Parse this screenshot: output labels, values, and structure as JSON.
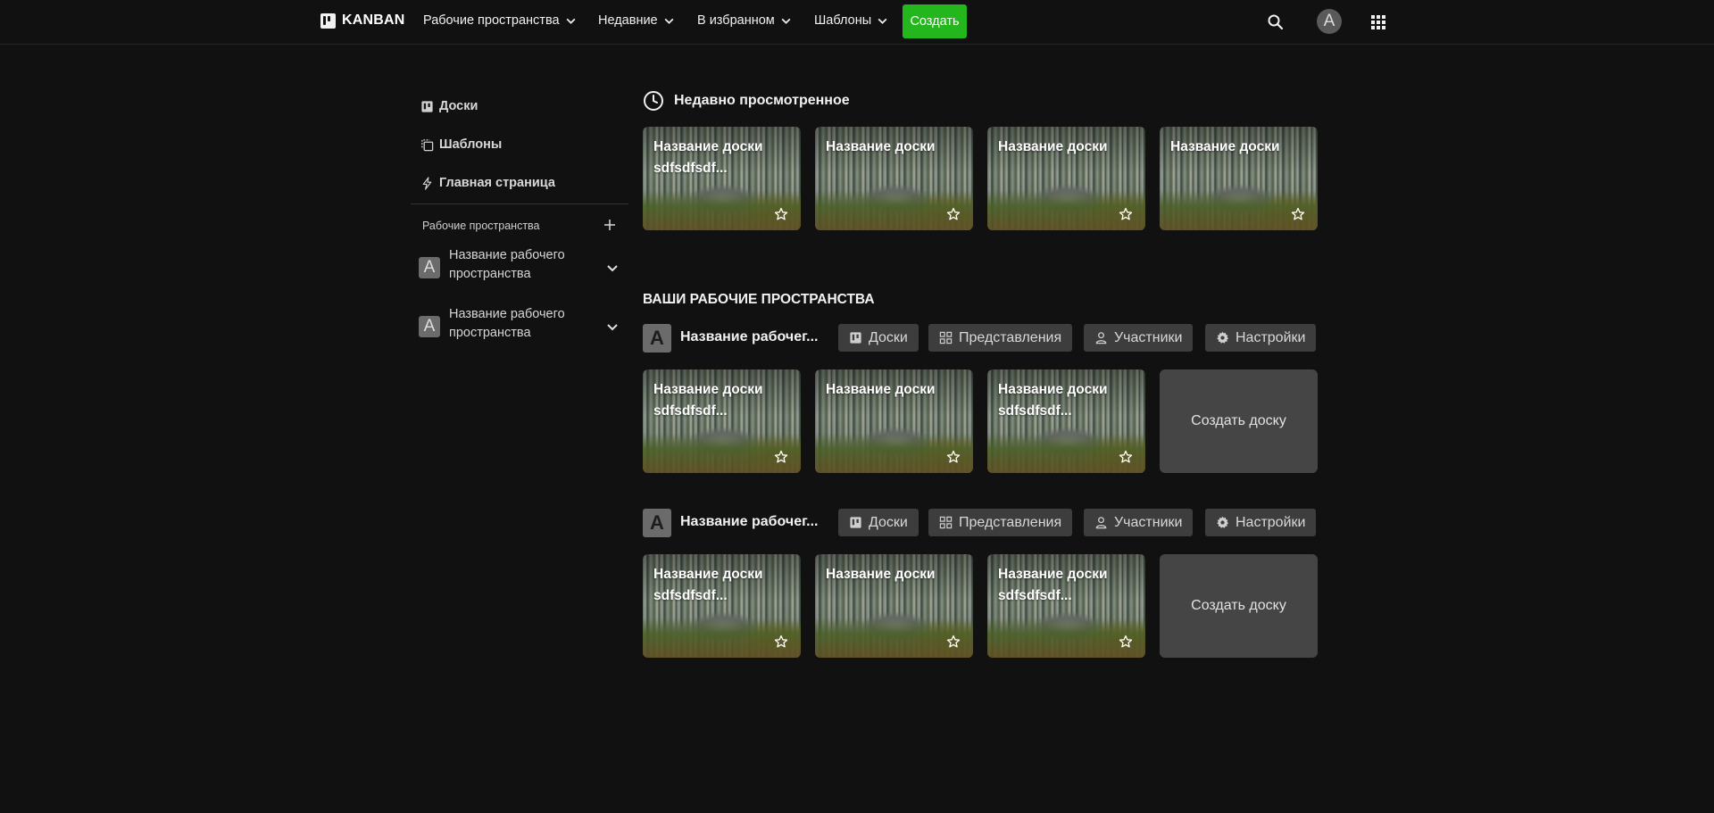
{
  "header": {
    "logo_text": "KANBAN",
    "nav": [
      {
        "label": "Рабочие пространства"
      },
      {
        "label": "Недавние"
      },
      {
        "label": "В избранном"
      },
      {
        "label": "Шаблоны"
      }
    ],
    "create_label": "Создать",
    "avatar_letter": "A",
    "accent_color": "#23b61d"
  },
  "sidebar": {
    "links": [
      {
        "label": "Доски",
        "icon": "board-icon"
      },
      {
        "label": "Шаблоны",
        "icon": "templates-icon"
      },
      {
        "label": "Главная страница",
        "icon": "lightning-icon"
      }
    ],
    "workspaces_heading": "Рабочие пространства",
    "workspaces": [
      {
        "letter": "A",
        "name": "Название рабочего пространства"
      },
      {
        "letter": "A",
        "name": "Название рабочего пространства"
      }
    ]
  },
  "recent": {
    "title": "Недавно просмотренное",
    "boards": [
      {
        "title": "Название доски sdfsdfsdf..."
      },
      {
        "title": "Название доски"
      },
      {
        "title": "Название доски"
      },
      {
        "title": "Название доски"
      }
    ]
  },
  "your_workspaces": {
    "title": "ВАШИ РАБОЧИЕ ПРОСТРАНСТВА",
    "button_labels": {
      "boards": "Доски",
      "views": "Представления",
      "members": "Участники",
      "settings": "Настройки"
    },
    "create_board_label": "Создать доску",
    "workspaces": [
      {
        "letter": "A",
        "title": "Название рабочег...",
        "boards": [
          {
            "title": "Название доски sdfsdfsdf..."
          },
          {
            "title": "Название доски"
          },
          {
            "title": "Название доски sdfsdfsdf..."
          }
        ]
      },
      {
        "letter": "A",
        "title": "Название рабочег...",
        "boards": [
          {
            "title": "Название доски sdfsdfsdf..."
          },
          {
            "title": "Название доски"
          },
          {
            "title": "Название доски sdfsdfsdf..."
          }
        ]
      }
    ]
  }
}
